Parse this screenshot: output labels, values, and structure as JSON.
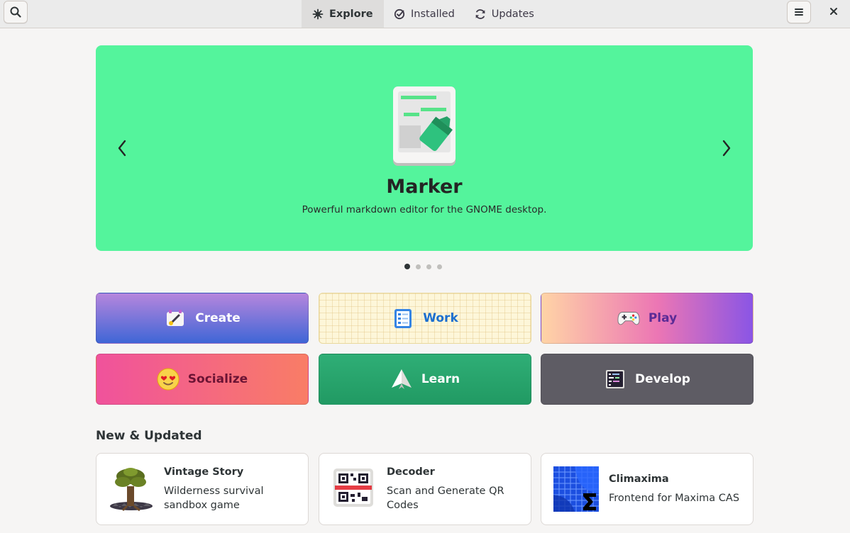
{
  "header": {
    "tabs": [
      {
        "label": "Explore",
        "icon": "explore-icon",
        "active": true
      },
      {
        "label": "Installed",
        "icon": "check-circle-icon",
        "active": false
      },
      {
        "label": "Updates",
        "icon": "refresh-icon",
        "active": false
      }
    ],
    "search_icon": "search-icon",
    "menu_icon": "hamburger-menu-icon",
    "close_icon": "close-icon"
  },
  "carousel": {
    "title": "Marker",
    "subtitle": "Powerful markdown editor for the GNOME desktop.",
    "background": "#54f49c",
    "pages": 4,
    "current_page": 1
  },
  "categories": [
    {
      "label": "Create",
      "icon": "create-icon"
    },
    {
      "label": "Work",
      "icon": "work-icon"
    },
    {
      "label": "Play",
      "icon": "gamepad-icon"
    },
    {
      "label": "Socialize",
      "icon": "heart-eyes-emoji-icon"
    },
    {
      "label": "Learn",
      "icon": "paper-plane-icon"
    },
    {
      "label": "Develop",
      "icon": "terminal-icon"
    }
  ],
  "new_updated": {
    "title": "New & Updated",
    "apps": [
      {
        "name": "Vintage Story",
        "description": "Wilderness survival sandbox game"
      },
      {
        "name": "Decoder",
        "description": "Scan and Generate QR Codes"
      },
      {
        "name": "Climaxima",
        "description": "Frontend for Maxima CAS"
      }
    ]
  }
}
